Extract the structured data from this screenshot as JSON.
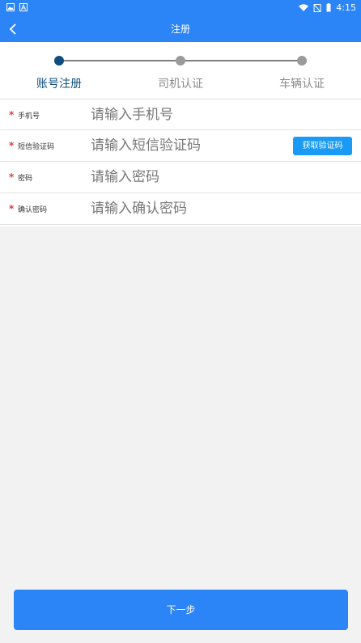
{
  "status_bar": {
    "time": "4:15",
    "left_icons": [
      "image-icon",
      "a-icon"
    ],
    "right_icons": [
      "wifi-icon",
      "no-sim-icon",
      "battery-icon"
    ]
  },
  "app_bar": {
    "title": "注册",
    "back_icon": "chevron-left-icon"
  },
  "steps": [
    {
      "label": "账号注册",
      "active": true
    },
    {
      "label": "司机认证",
      "active": false
    },
    {
      "label": "车辆认证",
      "active": false
    }
  ],
  "form": {
    "fields": [
      {
        "label": "手机号",
        "placeholder": "请输入手机号",
        "required": true,
        "value": ""
      },
      {
        "label": "短信验证码",
        "placeholder": "请输入短信验证码",
        "required": true,
        "value": ""
      },
      {
        "label": "密码",
        "placeholder": "请输入密码",
        "required": true,
        "value": ""
      },
      {
        "label": "确认密码",
        "placeholder": "请输入确认密码",
        "required": true,
        "value": ""
      }
    ],
    "required_mark": "*",
    "get_code_label": "获取验证码"
  },
  "next_button_label": "下一步",
  "colors": {
    "primary": "#2b85f6",
    "active_step": "#0d4e7f",
    "inactive_step": "#9a9a9a",
    "required": "#e23b3b",
    "code_button": "#1a9af4",
    "background": "#f2f2f2"
  }
}
